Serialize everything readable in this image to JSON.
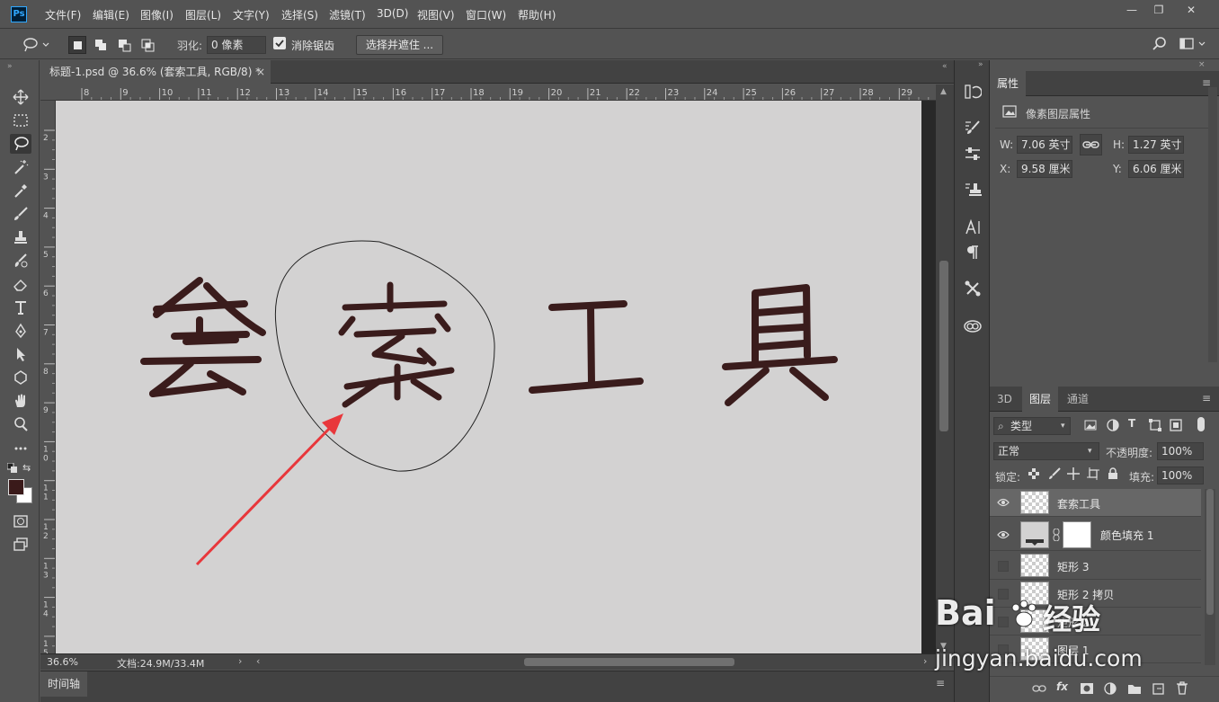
{
  "app": {
    "logo": "Ps"
  },
  "menu": [
    "文件(F)",
    "编辑(E)",
    "图像(I)",
    "图层(L)",
    "文字(Y)",
    "选择(S)",
    "滤镜(T)",
    "3D(D)",
    "视图(V)",
    "窗口(W)",
    "帮助(H)"
  ],
  "window_controls": {
    "minimize": "—",
    "restore": "❐",
    "close": "✕"
  },
  "options": {
    "feather_label": "羽化:",
    "feather_value": "0 像素",
    "antialias_label": "消除锯齿",
    "select_mask_button": "选择并遮住 ..."
  },
  "document": {
    "tab_title": "标题-1.psd @ 36.6% (套索工具, RGB/8) *",
    "tab_close": "×",
    "ruler_top": [
      "8",
      "9",
      "10",
      "11",
      "12",
      "13",
      "14",
      "15",
      "16",
      "17",
      "18",
      "19",
      "20",
      "21",
      "22",
      "23",
      "24",
      "25",
      "26",
      "27",
      "28",
      "29"
    ],
    "ruler_left": [
      "2",
      "3",
      "4",
      "5",
      "6",
      "7",
      "8",
      "9",
      "10",
      "11",
      "12",
      "13",
      "14",
      "15"
    ],
    "canvas_text": [
      "套",
      "索",
      "工",
      "具"
    ],
    "text_color": "#3a1c1c",
    "arrow_color": "#e8373b",
    "canvas_color": "#d3d2d2"
  },
  "status": {
    "zoom": "36.6%",
    "doc_size": "文档:24.9M/33.4M"
  },
  "timeline": {
    "label": "时间轴"
  },
  "properties": {
    "tab": "属性",
    "header": "像素图层属性",
    "w_label": "W:",
    "w_value": "7.06 英寸",
    "h_label": "H:",
    "h_value": "1.27 英寸",
    "x_label": "X:",
    "x_value": "9.58 厘米",
    "y_label": "Y:",
    "y_value": "6.06 厘米"
  },
  "layers_panel": {
    "tabs": [
      "3D",
      "图层",
      "通道"
    ],
    "filter_label": "类型",
    "blend_mode": "正常",
    "opacity_label": "不透明度:",
    "opacity_value": "100%",
    "lock_label": "锁定:",
    "fill_label": "填充:",
    "fill_value": "100%",
    "layers": [
      {
        "name": "套索工具",
        "visible": true,
        "selected": true
      },
      {
        "name": "颜色填充 1",
        "visible": true,
        "selected": false
      },
      {
        "name": "矩形 3",
        "visible": false,
        "selected": false
      },
      {
        "name": "矩形 2 拷贝",
        "visible": false,
        "selected": false
      },
      {
        "name": "矩形 2",
        "visible": false,
        "selected": false
      },
      {
        "name": "图层 1",
        "visible": false,
        "selected": false
      }
    ],
    "bottom_icons": [
      "link-icon",
      "fx-icon",
      "mask-icon",
      "adjustment-icon",
      "folder-icon",
      "new-layer-icon",
      "trash-icon"
    ],
    "fx_label": "fx"
  },
  "watermark": {
    "brand": "Bai",
    "brand2": "经验",
    "url": "jingyan.baidu.com"
  }
}
